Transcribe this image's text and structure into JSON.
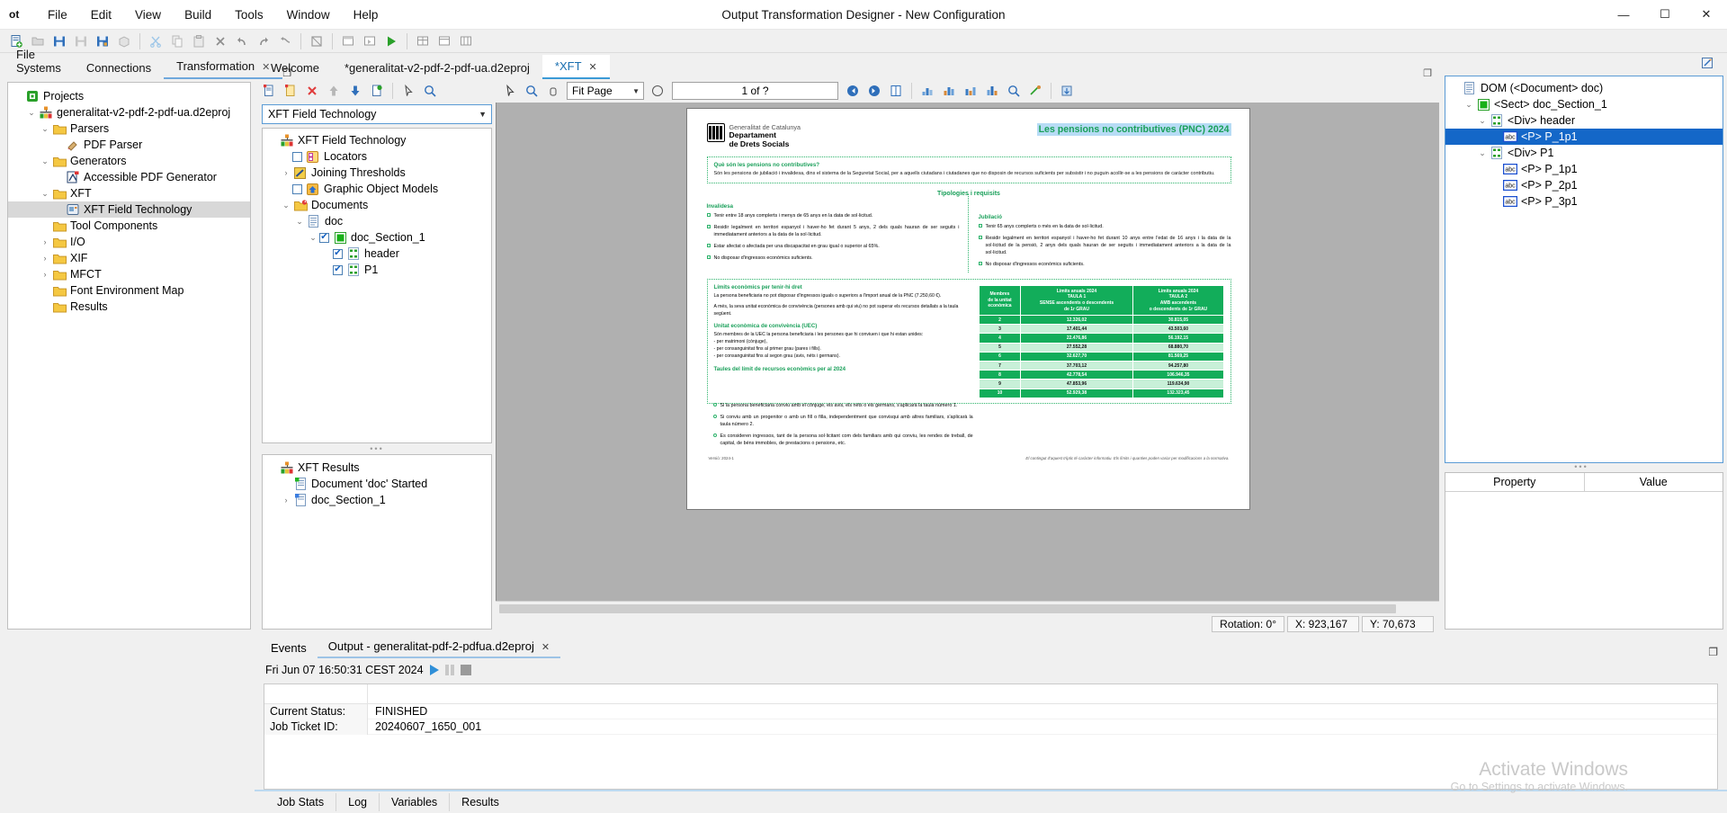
{
  "window": {
    "app_abbrev": "ot",
    "title": "Output Transformation Designer - New Configuration",
    "minimize": "—",
    "maximize": "☐",
    "close": "✕"
  },
  "menubar": [
    "File",
    "Edit",
    "View",
    "Build",
    "Tools",
    "Window",
    "Help"
  ],
  "left_dock": {
    "tabs": [
      {
        "label": "File Systems",
        "active": false
      },
      {
        "label": "Connections",
        "active": false
      },
      {
        "label": "Transformation",
        "active": true,
        "close": "✕"
      }
    ],
    "tree": [
      {
        "depth": 0,
        "twist": "",
        "icon": "projects-icon",
        "label": "Projects"
      },
      {
        "depth": 1,
        "twist": "⌄",
        "icon": "project-icon",
        "label": "generalitat-v2-pdf-2-pdf-ua.d2eproj"
      },
      {
        "depth": 2,
        "twist": "⌄",
        "icon": "folder-icon",
        "label": "Parsers"
      },
      {
        "depth": 3,
        "twist": "",
        "icon": "pdf-parser-icon",
        "label": "PDF Parser"
      },
      {
        "depth": 2,
        "twist": "⌄",
        "icon": "folder-icon",
        "label": "Generators"
      },
      {
        "depth": 3,
        "twist": "",
        "icon": "accessible-pdf-generator-icon",
        "label": "Accessible PDF Generator"
      },
      {
        "depth": 2,
        "twist": "⌄",
        "icon": "folder-icon",
        "label": "XFT"
      },
      {
        "depth": 3,
        "twist": "",
        "icon": "xft-field-technology-icon",
        "label": "XFT Field Technology",
        "selected": true
      },
      {
        "depth": 2,
        "twist": "",
        "icon": "folder-icon",
        "label": "Tool Components"
      },
      {
        "depth": 2,
        "twist": "›",
        "icon": "folder-icon",
        "label": "I/O"
      },
      {
        "depth": 2,
        "twist": "›",
        "icon": "folder-icon",
        "label": "XIF"
      },
      {
        "depth": 2,
        "twist": "›",
        "icon": "folder-icon",
        "label": "MFCT"
      },
      {
        "depth": 2,
        "twist": "",
        "icon": "folder-icon",
        "label": "Font Environment Map"
      },
      {
        "depth": 2,
        "twist": "",
        "icon": "folder-icon",
        "label": "Results"
      }
    ]
  },
  "editor": {
    "tabs": [
      {
        "label": "Welcome",
        "active": false
      },
      {
        "label": "*generalitat-v2-pdf-2-pdf-ua.d2eproj",
        "active": false
      },
      {
        "label": "*XFT",
        "active": true,
        "close": "✕"
      }
    ]
  },
  "xft_panel": {
    "combo_value": "XFT Field Technology",
    "combo_arrow": "▼",
    "tree": [
      {
        "depth": 0,
        "twist": "",
        "check": null,
        "icon": "xft-root-icon",
        "label": "XFT Field Technology"
      },
      {
        "depth": 1,
        "twist": "",
        "check": false,
        "icon": "locators-icon",
        "label": "Locators"
      },
      {
        "depth": 1,
        "twist": "›",
        "check": null,
        "icon": "joining-thresholds-icon",
        "label": "Joining Thresholds"
      },
      {
        "depth": 1,
        "twist": "",
        "check": false,
        "icon": "graphic-object-models-icon",
        "label": "Graphic Object Models"
      },
      {
        "depth": 1,
        "twist": "⌄",
        "check": null,
        "icon": "documents-icon",
        "label": "Documents"
      },
      {
        "depth": 2,
        "twist": "⌄",
        "check": null,
        "icon": "document-icon",
        "label": "doc"
      },
      {
        "depth": 3,
        "twist": "⌄",
        "check": true,
        "icon": "section-icon",
        "label": "doc_Section_1"
      },
      {
        "depth": 4,
        "twist": "",
        "check": true,
        "icon": "div-icon",
        "label": "header"
      },
      {
        "depth": 4,
        "twist": "",
        "check": true,
        "icon": "div-icon",
        "label": "P1"
      }
    ],
    "results_title": "XFT Results",
    "results": [
      {
        "depth": 1,
        "twist": "",
        "icon": "doc-started-icon",
        "label": "Document 'doc' Started"
      },
      {
        "depth": 1,
        "twist": "›",
        "icon": "section-result-icon",
        "label": "doc_Section_1"
      }
    ]
  },
  "preview": {
    "fit_mode": "Fit Page",
    "fit_arrow": "▼",
    "page_indicator": "1 of ?",
    "rotation_label": "Rotation: 0°",
    "x_label": "X: 923,167",
    "y_label": "Y: 70,673"
  },
  "dom_panel": {
    "tree": [
      {
        "depth": 0,
        "twist": "",
        "icon": "document-icon",
        "label": "DOM (<Document> doc)"
      },
      {
        "depth": 1,
        "twist": "⌄",
        "icon": "sect-icon",
        "label": "<Sect> doc_Section_1"
      },
      {
        "depth": 2,
        "twist": "⌄",
        "icon": "div-icon",
        "label": "<Div> header"
      },
      {
        "depth": 3,
        "twist": "",
        "icon": "abc-icon",
        "label": "<P> P_1p1",
        "selected": true
      },
      {
        "depth": 2,
        "twist": "⌄",
        "icon": "div-icon",
        "label": "<Div> P1"
      },
      {
        "depth": 3,
        "twist": "",
        "icon": "abc-icon",
        "label": "<P> P_1p1"
      },
      {
        "depth": 3,
        "twist": "",
        "icon": "abc-icon",
        "label": "<P> P_2p1"
      },
      {
        "depth": 3,
        "twist": "",
        "icon": "abc-icon",
        "label": "<P> P_3p1"
      }
    ],
    "property_header": "Property",
    "value_header": "Value"
  },
  "bottom_dock": {
    "tabs": [
      {
        "label": "Events",
        "active": false
      },
      {
        "label": "Output - generalitat-pdf-2-pdfua.d2eproj",
        "active": true,
        "close": "✕"
      }
    ],
    "timestamp": "Fri Jun 07 16:50:31 CEST 2024",
    "rows": [
      {
        "key": "Current Status:",
        "value": "FINISHED"
      },
      {
        "key": "Job Ticket ID:",
        "value": "20240607_1650_001"
      }
    ],
    "subtabs": [
      "Job Stats",
      "Log",
      "Variables",
      "Results"
    ]
  },
  "watermark": {
    "line1": "Activate Windows",
    "line2": "Go to Settings to activate Windows."
  },
  "document": {
    "org_line1": "Generalitat de Catalunya",
    "org_line2": "Departament",
    "org_line3": "de Drets Socials",
    "title": "Les pensions no contributives (PNC) 2024",
    "intro_heading": "Què són les pensions no contributives?",
    "intro_text": "Són les pensions de jubilació i invalidesa, dins el sistema de la Seguretat Social, per a aquells ciutadans i ciutadanes que no disposin de recursos suficients per subsistir i no puguin acollir-se a les pensions de caràcter contributiu.",
    "section_title": "Tipologies i requisits",
    "left_heading": "Invalidesa",
    "left_bullets": [
      "Tenir entre 18 anys complerts i menys de 65 anys en la data de sol·licitud.",
      "Residir legalment en territori espanyol i haver-ho fet durant 5 anys, 2 dels quals hauran de ser seguits i immediatament anteriors a la data de la sol·licitud.",
      "Estar afectat o afectada per una discapacitat en grau igual o superior al 65%.",
      "No disposar d'ingressos econòmics suficients."
    ],
    "right_heading": "Jubilació",
    "right_bullets": [
      "Tenir 65 anys complerts o més en la data de sol·licitud.",
      "Residir legalment en territori espanyol i haver-ho fet durant 10 anys entre l'edat de 16 anys i la data de la sol·licitud de la pensió, 2 anys dels quals hauran de ser seguits i immediatament anteriors a la data de la sol·licitud.",
      "No disposar d'ingressos econòmics suficients."
    ],
    "limits_heading": "Límits econòmics per tenir-hi dret",
    "limits_text1": "La persona beneficiaria no pot disposar d'ingressos iguals o superiors a l'import anual de la PNC (7.250,60 €).",
    "limits_text2": "A més, la seva unitat econòmica de convivència (persones amb qui viu) no pot superar els recursos detallats a la taula següent.",
    "uec_heading": "Unitat econòmica de convivència (UEC)",
    "uec_text": "Són membres de la UEC la persona beneficiaria i les persones que hi conviuen i que hi estan unides:",
    "uec_items": [
      "per matrimoni (cònjuge),",
      "per consanguinitat fins al primer grau (pares i fills).",
      "per consanguinitat fins al segon grau (avis, néts i germans)."
    ],
    "tables_heading": "Taules del límit de recursos econòmics per al 2024",
    "notes": [
      "Si la persona beneficiaria conviu amb el cònjuge, els avis, els néts o els germans, s'aplicarà la taula número 1.",
      "Si conviu amb un progenitor o amb un fill o filla, independentment que convisqui amb altres familiars, s'aplicarà la taula número 2.",
      "Es consideren ingressos, tant de la persona sol·licitant com dels familiars amb qui conviu, les rendes de treball, de capital, de béns immobles, de prestacions o pensions, etc."
    ],
    "footer_left": "Versió: 2024-1",
    "footer_right": "El contingut d'aquest tríptic té caràcter informatiu. Els límits i quanties poden variar per modificacions a la normativa.",
    "table": {
      "headers": [
        "Membres\nde la unitat\neconòmica",
        "Límits anuals 2024\nTAULA 1\nSENSE ascendents o descendents\nde 1r GRAU",
        "Límits anuals 2024\nTAULA 2\nAMB ascendents\no descendents de 1r GRAU"
      ],
      "rows": [
        [
          "2",
          "12.326,02",
          "30.815,05"
        ],
        [
          "3",
          "17.401,44",
          "43.503,60"
        ],
        [
          "4",
          "22.476,86",
          "56.192,15"
        ],
        [
          "5",
          "27.552,28",
          "68.880,70"
        ],
        [
          "6",
          "32.627,70",
          "81.569,25"
        ],
        [
          "7",
          "37.703,12",
          "94.257,80"
        ],
        [
          "8",
          "42.778,54",
          "106.946,35"
        ],
        [
          "9",
          "47.853,96",
          "119.634,90"
        ],
        [
          "10",
          "52.929,38",
          "132.323,45"
        ]
      ]
    }
  }
}
